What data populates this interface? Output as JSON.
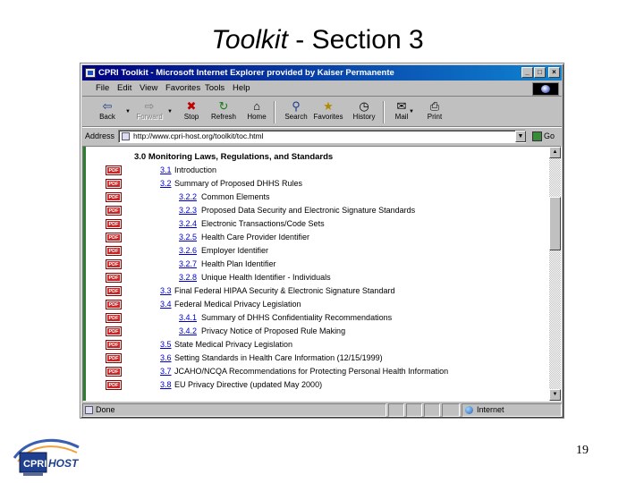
{
  "slide": {
    "title_italic": "Toolkit",
    "title_rest": " - Section 3",
    "page_number": "19",
    "logo_text_left": "CPRI",
    "logo_text_right": "HOST"
  },
  "browser": {
    "title": "CPRI Toolkit - Microsoft Internet Explorer provided by Kaiser Permanente",
    "window_buttons": [
      "_",
      "□",
      "×"
    ],
    "menu": [
      "File",
      "Edit",
      "View",
      "Favorites",
      "Tools",
      "Help"
    ],
    "toolbar": {
      "back": "Back",
      "forward": "Forward",
      "stop": "Stop",
      "refresh": "Refresh",
      "home": "Home",
      "search": "Search",
      "favorites": "Favorites",
      "history": "History",
      "mail": "Mail",
      "print": "Print"
    },
    "address_label": "Address",
    "address_value": "http://www.cpri-host.org/toolkit/toc.html",
    "go_label": "Go",
    "status_text": "Done",
    "zone_text": "Internet"
  },
  "toc": {
    "heading": "3.0 Monitoring Laws, Regulations, and Standards",
    "pdf_label": "PDF",
    "items": [
      {
        "num": "3.1",
        "text": "Introduction",
        "level": 1
      },
      {
        "num": "3.2",
        "text": "Summary of Proposed DHHS Rules",
        "level": 1
      },
      {
        "num": "3.2.2",
        "text": "Common Elements",
        "level": 2
      },
      {
        "num": "3.2.3",
        "text": "Proposed Data Security and Electronic Signature Standards",
        "level": 2
      },
      {
        "num": "3.2.4",
        "text": "Electronic Transactions/Code Sets",
        "level": 2
      },
      {
        "num": "3.2.5",
        "text": "Health Care Provider Identifier",
        "level": 2
      },
      {
        "num": "3.2.6",
        "text": "Employer Identifier",
        "level": 2
      },
      {
        "num": "3.2.7",
        "text": "Health Plan Identifier",
        "level": 2
      },
      {
        "num": "3.2.8",
        "text": "Unique Health Identifier - Individuals",
        "level": 2
      },
      {
        "num": "3.3",
        "text": "Final Federal HIPAA Security & Electronic Signature Standard",
        "level": 1
      },
      {
        "num": "3.4",
        "text": "Federal Medical Privacy Legislation",
        "level": 1
      },
      {
        "num": "3.4.1",
        "text": "Summary of DHHS Confidentiality Recommendations",
        "level": 2
      },
      {
        "num": "3.4.2",
        "text": "Privacy Notice of Proposed Rule Making",
        "level": 2
      },
      {
        "num": "3.5",
        "text": "State Medical Privacy Legislation",
        "level": 1
      },
      {
        "num": "3.6",
        "text": "Setting Standards in Health Care Information (12/15/1999)",
        "level": 1
      },
      {
        "num": "3.7",
        "text": "JCAHO/NCQA Recommendations for Protecting Personal Health Information",
        "level": 1
      },
      {
        "num": "3.8",
        "text": "EU Privacy Directive (updated May 2000)",
        "level": 1
      }
    ]
  },
  "colors": {
    "titlebar_start": "#000080",
    "titlebar_end": "#1084d0",
    "link": "#0000cc",
    "pdf_badge": "#c62828",
    "left_bar": "#2e7d32"
  },
  "icons": {
    "back": "back-arrow-icon",
    "forward": "forward-arrow-icon",
    "stop": "stop-icon",
    "refresh": "refresh-icon",
    "home": "home-icon",
    "search": "search-icon",
    "favorites": "favorites-icon",
    "history": "history-icon",
    "mail": "mail-icon",
    "print": "printer-icon"
  }
}
